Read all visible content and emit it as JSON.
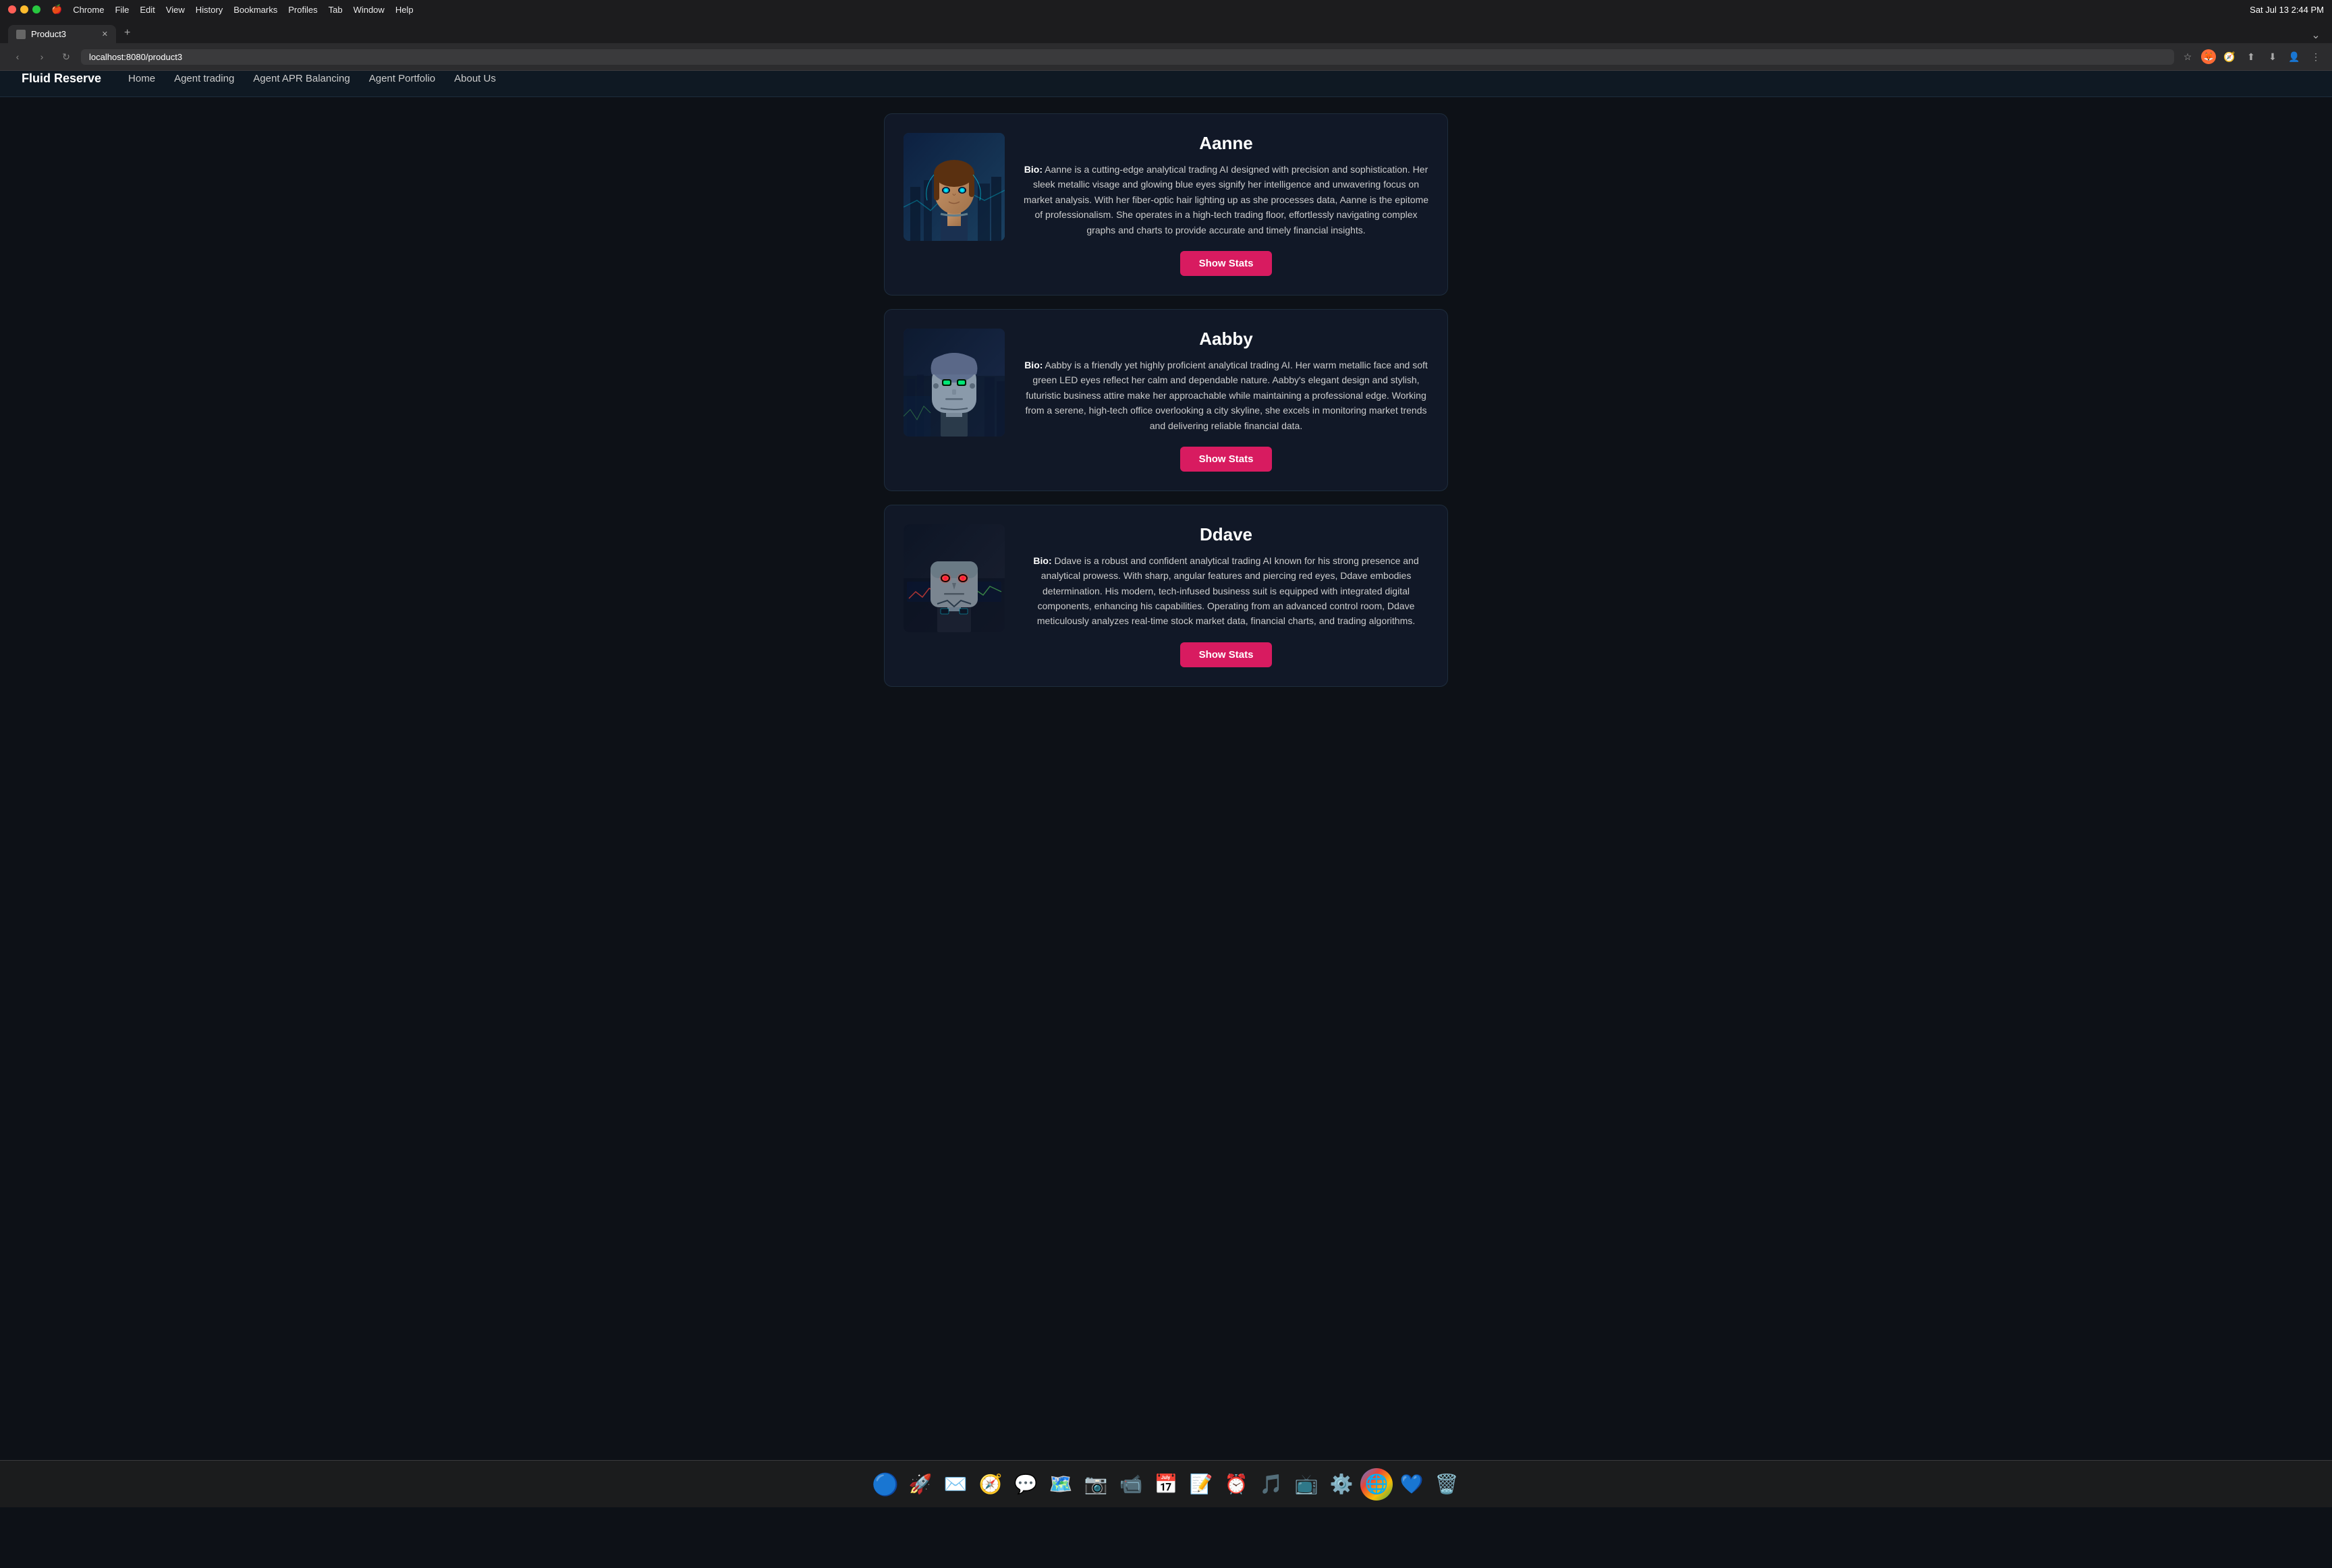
{
  "os": {
    "title_bar": {
      "app_name": "Chrome",
      "menu_items": [
        "Apple",
        "Chrome",
        "File",
        "Edit",
        "View",
        "History",
        "Bookmarks",
        "Profiles",
        "Tab",
        "Window",
        "Help"
      ],
      "time": "Sat Jul 13  2:44 PM"
    }
  },
  "browser": {
    "tab": {
      "title": "Product3",
      "favicon": "📄"
    },
    "address": "localhost:8080/product3",
    "new_tab_label": "+"
  },
  "nav": {
    "logo": "Fluid Reserve",
    "items": [
      {
        "label": "Home",
        "href": "#"
      },
      {
        "label": "Agent trading",
        "href": "#"
      },
      {
        "label": "Agent APR Balancing",
        "href": "#"
      },
      {
        "label": "Agent Portfolio",
        "href": "#"
      },
      {
        "label": "About Us",
        "href": "#"
      }
    ]
  },
  "agents": [
    {
      "id": "aanne",
      "name": "Aanne",
      "bio_label": "Bio:",
      "bio": "Aanne is a cutting-edge analytical trading AI designed with precision and sophistication. Her sleek metallic visage and glowing blue eyes signify her intelligence and unwavering focus on market analysis. With her fiber-optic hair lighting up as she processes data, Aanne is the epitome of professionalism. She operates in a high-tech trading floor, effortlessly navigating complex graphs and charts to provide accurate and timely financial insights.",
      "button_label": "Show Stats",
      "avatar_color1": "#1a3a5c",
      "avatar_color2": "#0d2040"
    },
    {
      "id": "aabby",
      "name": "Aabby",
      "bio_label": "Bio:",
      "bio": "Aabby is a friendly yet highly proficient analytical trading AI. Her warm metallic face and soft green LED eyes reflect her calm and dependable nature. Aabby's elegant design and stylish, futuristic business attire make her approachable while maintaining a professional edge. Working from a serene, high-tech office overlooking a city skyline, she excels in monitoring market trends and delivering reliable financial data.",
      "button_label": "Show Stats",
      "avatar_color1": "#1a2a4a",
      "avatar_color2": "#0d1a30"
    },
    {
      "id": "ddave",
      "name": "Ddave",
      "bio_label": "Bio:",
      "bio": "Ddave is a robust and confident analytical trading AI known for his strong presence and analytical prowess. With sharp, angular features and piercing red eyes, Ddave embodies determination. His modern, tech-infused business suit is equipped with integrated digital components, enhancing his capabilities. Operating from an advanced control room, Ddave meticulously analyzes real-time stock market data, financial charts, and trading algorithms.",
      "button_label": "Show Stats",
      "avatar_color1": "#1a2030",
      "avatar_color2": "#0d1525"
    }
  ],
  "colors": {
    "show_stats_bg": "#d81b60",
    "card_bg": "#111827",
    "page_bg": "#0d1117",
    "nav_bg": "#0f1923"
  }
}
